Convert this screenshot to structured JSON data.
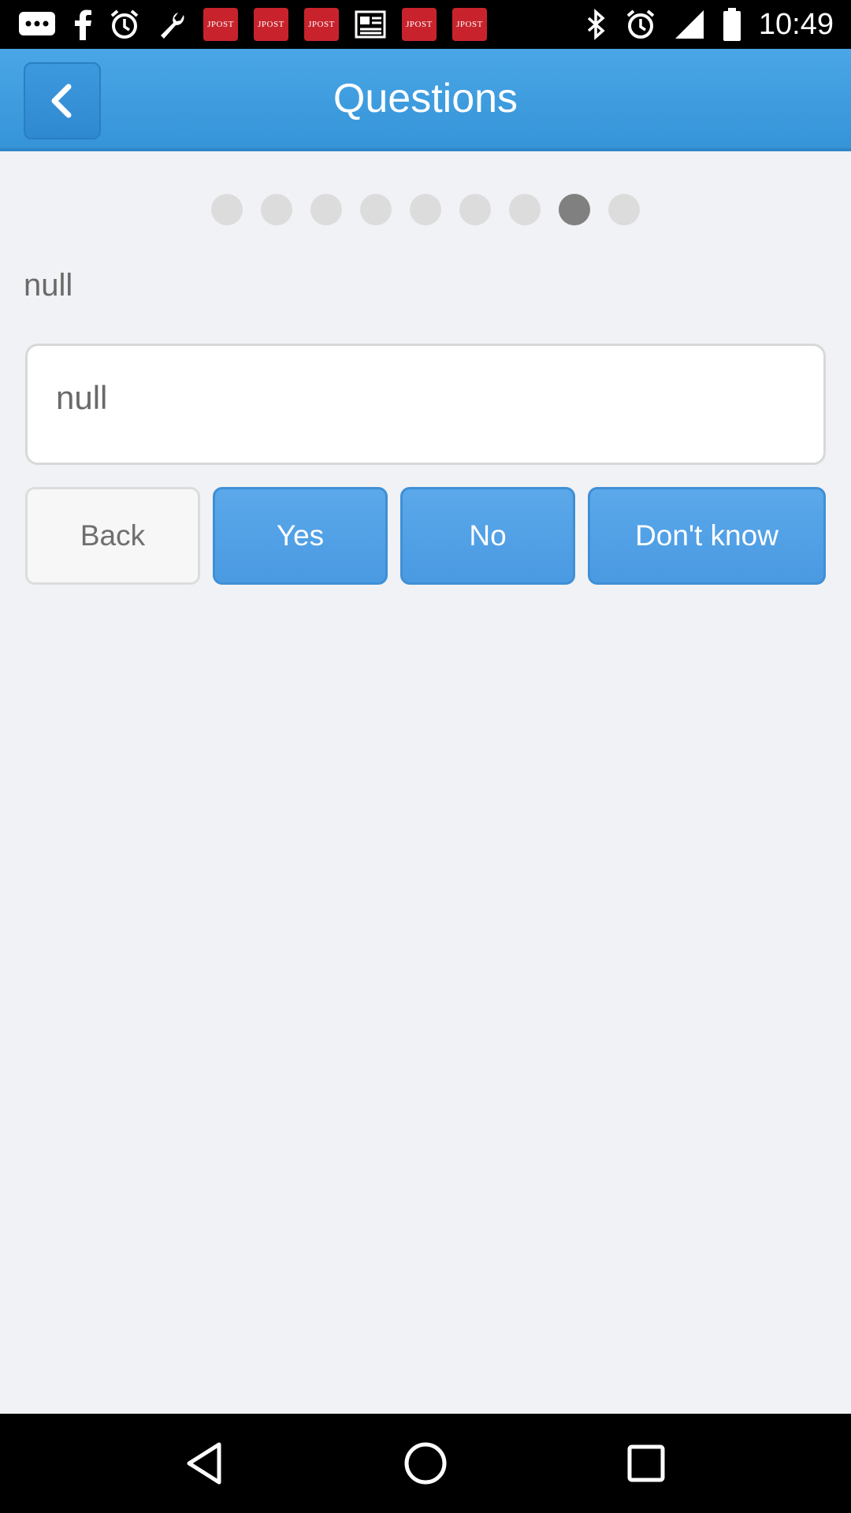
{
  "status_bar": {
    "time": "10:49",
    "notifications": [
      "messages-icon",
      "facebook-icon",
      "alarm-icon",
      "wrench-icon",
      "jpost-icon",
      "jpost-icon",
      "jpost-icon",
      "news-icon",
      "jpost-icon",
      "jpost-icon"
    ],
    "jpost_label": "JPOST"
  },
  "header": {
    "title": "Questions"
  },
  "progress": {
    "total": 9,
    "current": 8
  },
  "question": {
    "label": "null",
    "answer_text": "null"
  },
  "buttons": {
    "back": "Back",
    "yes": "Yes",
    "no": "No",
    "dont_know": "Don't know"
  },
  "colors": {
    "header_blue": "#3d9be0",
    "button_blue": "#4f9fe4",
    "active_dot": "#808080",
    "inactive_dot": "#dcdcdc"
  }
}
